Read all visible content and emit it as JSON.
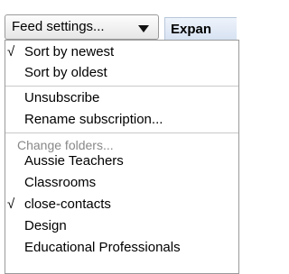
{
  "toolbar": {
    "feed_settings_label": "Feed settings...",
    "expand_label": "Expan"
  },
  "menu": {
    "sort_items": [
      {
        "label": "Sort by newest",
        "checked": true
      },
      {
        "label": "Sort by oldest",
        "checked": false
      }
    ],
    "subscription_items": [
      {
        "label": "Unsubscribe"
      },
      {
        "label": "Rename subscription..."
      }
    ],
    "folders_header": "Change folders...",
    "folder_items": [
      {
        "label": "Aussie Teachers",
        "checked": false
      },
      {
        "label": "Classrooms",
        "checked": false
      },
      {
        "label": "close-contacts",
        "checked": true
      },
      {
        "label": "Design",
        "checked": false
      },
      {
        "label": "Educational Professionals",
        "checked": false
      }
    ],
    "check_glyph": "√"
  }
}
